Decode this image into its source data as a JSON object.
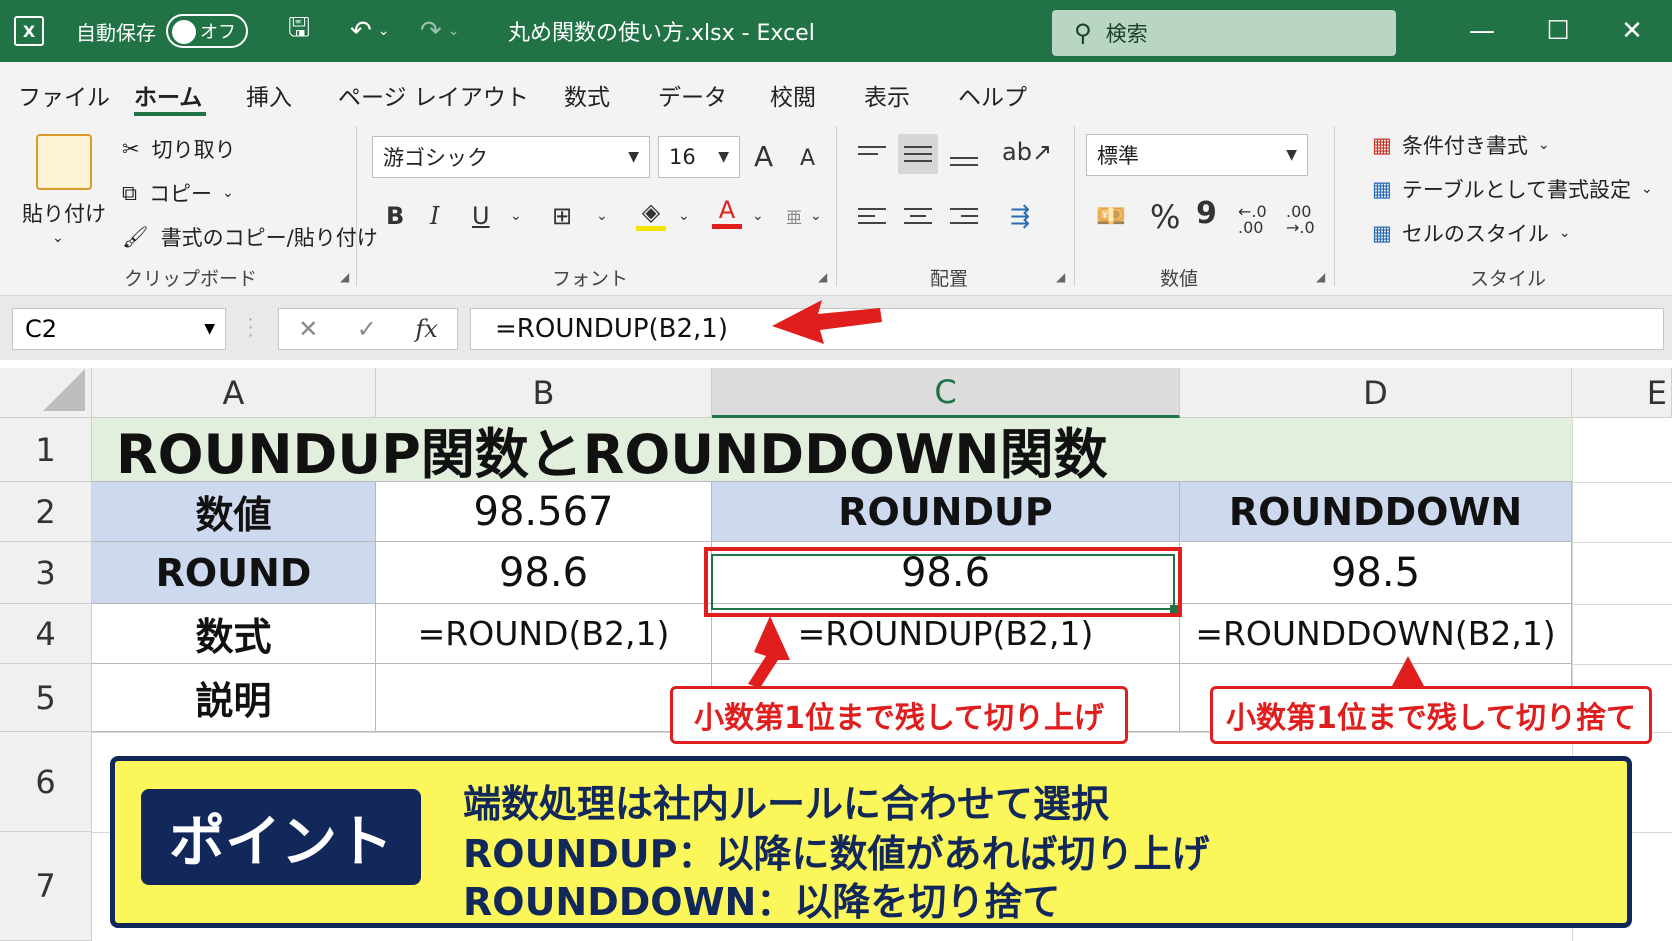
{
  "window": {
    "autosave_label": "自動保存",
    "autosave_state": "オフ",
    "doc_title": "丸め関数の使い方.xlsx  -  Excel",
    "search_placeholder": "検索"
  },
  "menu": [
    "ファイル",
    "ホーム",
    "挿入",
    "ページ レイアウト",
    "数式",
    "データ",
    "校閲",
    "表示",
    "ヘルプ"
  ],
  "ribbon": {
    "clipboard": {
      "paste": "貼り付け",
      "cut": "切り取り",
      "copy": "コピー",
      "format_painter": "書式のコピー/貼り付け",
      "label": "クリップボード"
    },
    "font": {
      "name": "游ゴシック",
      "size": "16",
      "bold": "B",
      "italic": "I",
      "underline": "U",
      "font_color": "A",
      "grow": "A",
      "shrink": "A",
      "label": "フォント"
    },
    "alignment": {
      "label": "配置"
    },
    "number": {
      "format": "標準",
      "percent": "%",
      "comma": "9",
      "inc_decimal": "←.0 .00",
      "dec_decimal": ".00 →.0",
      "label": "数値"
    },
    "styles": {
      "conditional": "条件付き書式",
      "table": "テーブルとして書式設定",
      "cell_styles": "セルのスタイル",
      "label": "スタイル"
    }
  },
  "formula_bar": {
    "name_box": "C2",
    "cancel": "✕",
    "enter": "✓",
    "fx": "fx",
    "formula": "=ROUNDUP(B2,1)"
  },
  "columns": [
    "A",
    "B",
    "C",
    "D",
    "E"
  ],
  "rows": [
    "1",
    "2",
    "3",
    "4",
    "5",
    "6",
    "7"
  ],
  "sheet": {
    "title": "ROUNDUP関数とROUNDDOWN関数",
    "r2": [
      "数値",
      "98.567",
      "ROUNDUP",
      "ROUNDDOWN"
    ],
    "r3": [
      "ROUND",
      "98.6",
      "98.6",
      "98.5"
    ],
    "r4": [
      "数式",
      "=ROUND(B2,1)",
      "=ROUNDUP(B2,1)",
      "=ROUNDDOWN(B2,1)"
    ],
    "r5": [
      "説明"
    ]
  },
  "annotations": {
    "callout_roundup": "小数第1位まで残して切り上げ",
    "callout_rounddown": "小数第1位まで残して切り捨て",
    "point_badge": "ポイント",
    "point_lines": [
      "端数処理は社内ルールに合わせて選択",
      "ROUNDUP：以降に数値があれば切り上げ",
      "ROUNDDOWN：以降を切り捨て"
    ]
  },
  "colors": {
    "excel_green": "#217346",
    "header_blue": "#cdd9ee",
    "title_green": "#e1efdc",
    "annotation_red": "#e01e1e",
    "point_yellow": "#fbf659",
    "point_navy": "#12285a"
  }
}
